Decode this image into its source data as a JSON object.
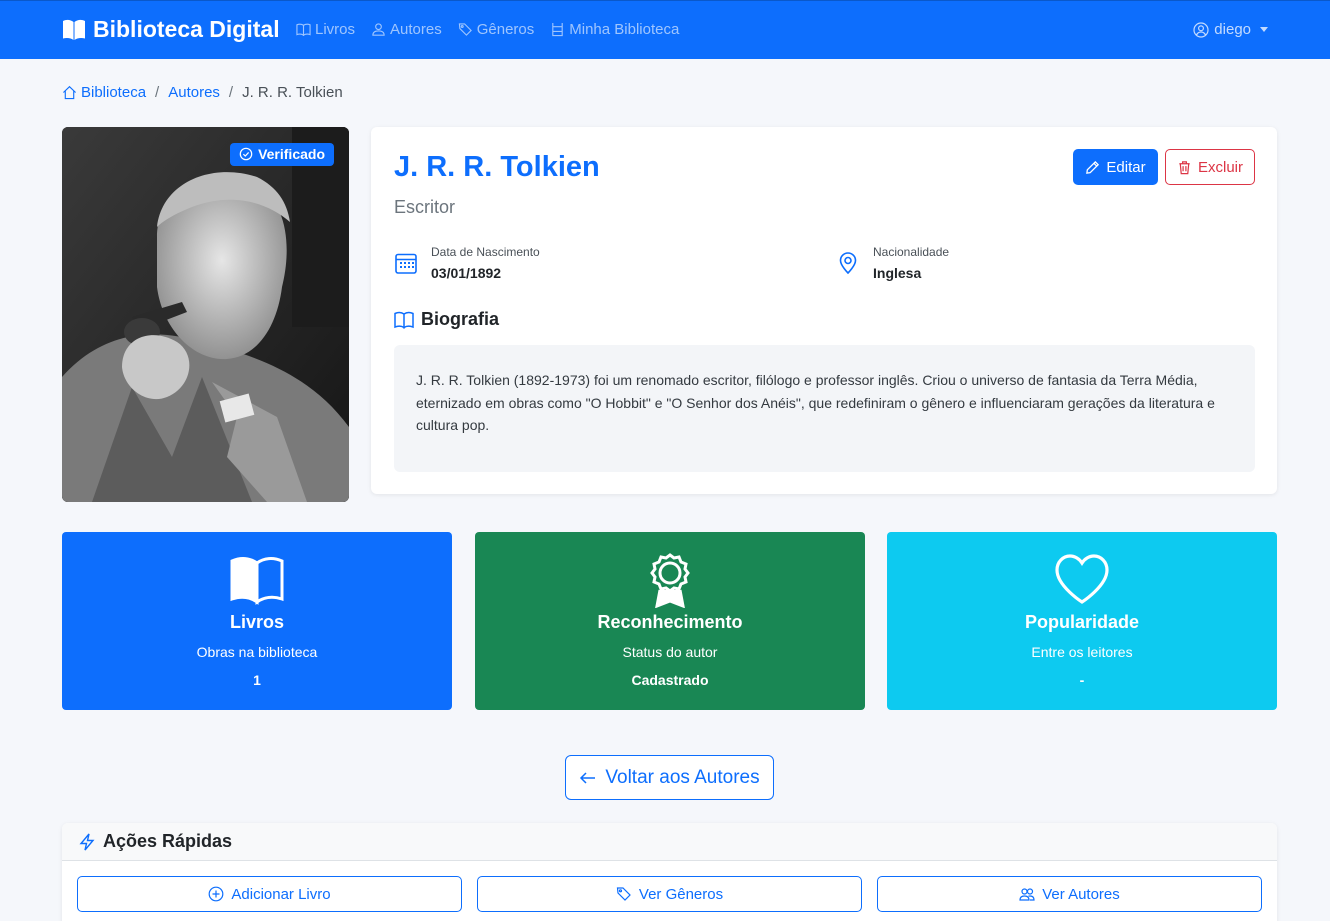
{
  "navbar": {
    "brand": "Biblioteca Digital",
    "links": [
      "Livros",
      "Autores",
      "Gêneros",
      "Minha Biblioteca"
    ],
    "user": "diego"
  },
  "breadcrumb": {
    "home": "Biblioteca",
    "section": "Autores",
    "current": "J. R. R. Tolkien"
  },
  "photo": {
    "badge": "Verificado"
  },
  "author": {
    "name": "J. R. R. Tolkien",
    "role": "Escritor",
    "birth_label": "Data de Nascimento",
    "birth_value": "03/01/1892",
    "nationality_label": "Nacionalidade",
    "nationality_value": "Inglesa",
    "bio_title": "Biografia",
    "bio": "J. R. R. Tolkien (1892-1973) foi um renomado escritor, filólogo e professor inglês. Criou o universo de fantasia da Terra Média, eternizado em obras como \"O Hobbit\" e \"O Senhor dos Anéis\", que redefiniram o gênero e influenciaram gerações da literatura e cultura pop."
  },
  "actions": {
    "edit": "Editar",
    "delete": "Excluir",
    "back": "Voltar aos Autores"
  },
  "stats": [
    {
      "title": "Livros",
      "subtitle": "Obras na biblioteca",
      "value": "1",
      "color": "#0d6efd"
    },
    {
      "title": "Reconhecimento",
      "subtitle": "Status do autor",
      "value": "Cadastrado",
      "color": "#198754"
    },
    {
      "title": "Popularidade",
      "subtitle": "Entre os leitores",
      "value": "-",
      "color": "#0dcaf0"
    }
  ],
  "quick_actions": {
    "title": "Ações Rápidas",
    "buttons": [
      "Adicionar Livro",
      "Ver Gêneros",
      "Ver Autores"
    ]
  },
  "colors": {
    "primary": "#0d6efd",
    "danger": "#dc3545",
    "success": "#198754",
    "info": "#0dcaf0"
  }
}
